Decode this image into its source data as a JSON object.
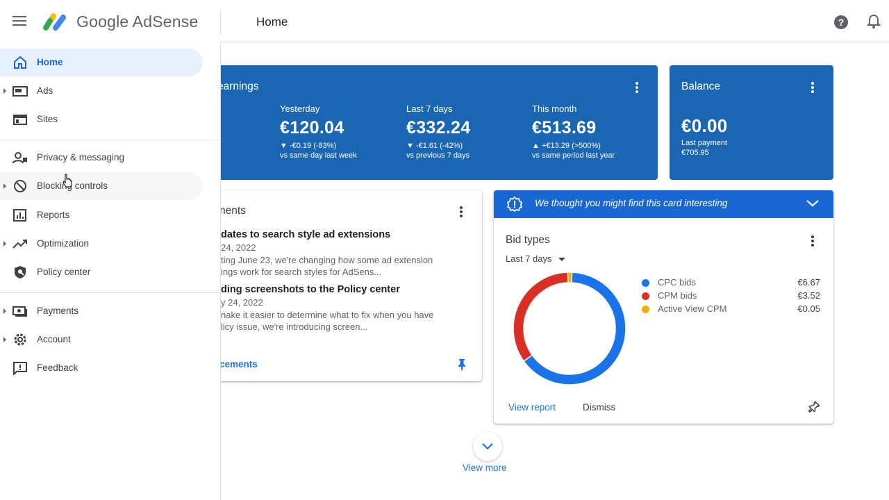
{
  "header": {
    "product_name": "Google AdSense",
    "page_title": "Home",
    "icons": [
      "menu-icon",
      "adsense-logo",
      "help-icon",
      "notifications-icon"
    ]
  },
  "sidebar": {
    "items": [
      {
        "label": "Home",
        "icon": "home-icon",
        "active": true
      },
      {
        "label": "Ads",
        "icon": "ads-icon"
      },
      {
        "label": "Sites",
        "icon": "sites-icon"
      },
      {
        "label": "Privacy & messaging",
        "icon": "privacy-icon"
      },
      {
        "label": "Blocking controls",
        "icon": "block-icon"
      },
      {
        "label": "Reports",
        "icon": "reports-icon"
      },
      {
        "label": "Optimization",
        "icon": "optimization-icon"
      },
      {
        "label": "Policy center",
        "icon": "policy-icon"
      },
      {
        "label": "Payments",
        "icon": "payments-icon"
      },
      {
        "label": "Account",
        "icon": "account-icon"
      },
      {
        "label": "Feedback",
        "icon": "feedback-icon"
      }
    ]
  },
  "earnings": {
    "title": "earnings",
    "stats": [
      {
        "label": "Yesterday",
        "value": "€120.04",
        "change": "▼ -€0.19 (-83%)",
        "compare": "vs same day last week"
      },
      {
        "label": "Last 7 days",
        "value": "€332.24",
        "change": "▼ -€1.61 (-42%)",
        "compare": "vs previous 7 days"
      },
      {
        "label": "This month",
        "value": "€513.69",
        "change": "▲ +€13.29 (>500%)",
        "compare": "vs same period last year"
      }
    ]
  },
  "balance": {
    "title": "Balance",
    "value": "€0.00",
    "last_payment_label": "Last payment",
    "last_payment_value": "€705.95"
  },
  "announcements": {
    "title": "nents",
    "items": [
      {
        "title": "dates to search style ad extensions",
        "date": " 24, 2022",
        "line1": "ting June 23, we're changing how some ad extension",
        "line2": "ings work for search styles for AdSens..."
      },
      {
        "title": "ding screenshots to the Policy center",
        "date": "y 24, 2022",
        "line1": "nake it easier to determine what to fix when you have",
        "line2": "licy issue, we're introducing screen..."
      }
    ],
    "link": "cements"
  },
  "suggestion_banner": {
    "text": "We thought you might find this card interesting"
  },
  "bid_types": {
    "title": "Bid types",
    "range": "Last 7 days",
    "view_report": "View report",
    "dismiss": "Dismiss"
  },
  "view_more": "View more",
  "colors": {
    "card_blue": "#1b66b3",
    "banner_blue": "#1967d2",
    "cpc": "#1a73e8",
    "cpm": "#d93025",
    "active_view": "#f9ab00"
  },
  "chart_data": {
    "type": "pie",
    "categories": [
      "CPC bids",
      "CPM bids",
      "Active View CPM"
    ],
    "values": [
      6.67,
      3.52,
      0.05
    ],
    "display_values": [
      "€6.67",
      "€3.52",
      "€0.05"
    ]
  }
}
